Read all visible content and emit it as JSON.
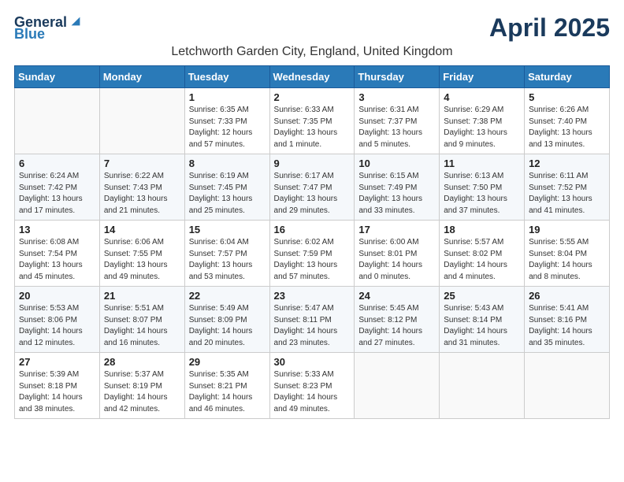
{
  "logo": {
    "general": "General",
    "blue": "Blue"
  },
  "title": "April 2025",
  "location": "Letchworth Garden City, England, United Kingdom",
  "weekdays": [
    "Sunday",
    "Monday",
    "Tuesday",
    "Wednesday",
    "Thursday",
    "Friday",
    "Saturday"
  ],
  "weeks": [
    [
      {
        "day": "",
        "info": ""
      },
      {
        "day": "",
        "info": ""
      },
      {
        "day": "1",
        "info": "Sunrise: 6:35 AM\nSunset: 7:33 PM\nDaylight: 12 hours and 57 minutes."
      },
      {
        "day": "2",
        "info": "Sunrise: 6:33 AM\nSunset: 7:35 PM\nDaylight: 13 hours and 1 minute."
      },
      {
        "day": "3",
        "info": "Sunrise: 6:31 AM\nSunset: 7:37 PM\nDaylight: 13 hours and 5 minutes."
      },
      {
        "day": "4",
        "info": "Sunrise: 6:29 AM\nSunset: 7:38 PM\nDaylight: 13 hours and 9 minutes."
      },
      {
        "day": "5",
        "info": "Sunrise: 6:26 AM\nSunset: 7:40 PM\nDaylight: 13 hours and 13 minutes."
      }
    ],
    [
      {
        "day": "6",
        "info": "Sunrise: 6:24 AM\nSunset: 7:42 PM\nDaylight: 13 hours and 17 minutes."
      },
      {
        "day": "7",
        "info": "Sunrise: 6:22 AM\nSunset: 7:43 PM\nDaylight: 13 hours and 21 minutes."
      },
      {
        "day": "8",
        "info": "Sunrise: 6:19 AM\nSunset: 7:45 PM\nDaylight: 13 hours and 25 minutes."
      },
      {
        "day": "9",
        "info": "Sunrise: 6:17 AM\nSunset: 7:47 PM\nDaylight: 13 hours and 29 minutes."
      },
      {
        "day": "10",
        "info": "Sunrise: 6:15 AM\nSunset: 7:49 PM\nDaylight: 13 hours and 33 minutes."
      },
      {
        "day": "11",
        "info": "Sunrise: 6:13 AM\nSunset: 7:50 PM\nDaylight: 13 hours and 37 minutes."
      },
      {
        "day": "12",
        "info": "Sunrise: 6:11 AM\nSunset: 7:52 PM\nDaylight: 13 hours and 41 minutes."
      }
    ],
    [
      {
        "day": "13",
        "info": "Sunrise: 6:08 AM\nSunset: 7:54 PM\nDaylight: 13 hours and 45 minutes."
      },
      {
        "day": "14",
        "info": "Sunrise: 6:06 AM\nSunset: 7:55 PM\nDaylight: 13 hours and 49 minutes."
      },
      {
        "day": "15",
        "info": "Sunrise: 6:04 AM\nSunset: 7:57 PM\nDaylight: 13 hours and 53 minutes."
      },
      {
        "day": "16",
        "info": "Sunrise: 6:02 AM\nSunset: 7:59 PM\nDaylight: 13 hours and 57 minutes."
      },
      {
        "day": "17",
        "info": "Sunrise: 6:00 AM\nSunset: 8:01 PM\nDaylight: 14 hours and 0 minutes."
      },
      {
        "day": "18",
        "info": "Sunrise: 5:57 AM\nSunset: 8:02 PM\nDaylight: 14 hours and 4 minutes."
      },
      {
        "day": "19",
        "info": "Sunrise: 5:55 AM\nSunset: 8:04 PM\nDaylight: 14 hours and 8 minutes."
      }
    ],
    [
      {
        "day": "20",
        "info": "Sunrise: 5:53 AM\nSunset: 8:06 PM\nDaylight: 14 hours and 12 minutes."
      },
      {
        "day": "21",
        "info": "Sunrise: 5:51 AM\nSunset: 8:07 PM\nDaylight: 14 hours and 16 minutes."
      },
      {
        "day": "22",
        "info": "Sunrise: 5:49 AM\nSunset: 8:09 PM\nDaylight: 14 hours and 20 minutes."
      },
      {
        "day": "23",
        "info": "Sunrise: 5:47 AM\nSunset: 8:11 PM\nDaylight: 14 hours and 23 minutes."
      },
      {
        "day": "24",
        "info": "Sunrise: 5:45 AM\nSunset: 8:12 PM\nDaylight: 14 hours and 27 minutes."
      },
      {
        "day": "25",
        "info": "Sunrise: 5:43 AM\nSunset: 8:14 PM\nDaylight: 14 hours and 31 minutes."
      },
      {
        "day": "26",
        "info": "Sunrise: 5:41 AM\nSunset: 8:16 PM\nDaylight: 14 hours and 35 minutes."
      }
    ],
    [
      {
        "day": "27",
        "info": "Sunrise: 5:39 AM\nSunset: 8:18 PM\nDaylight: 14 hours and 38 minutes."
      },
      {
        "day": "28",
        "info": "Sunrise: 5:37 AM\nSunset: 8:19 PM\nDaylight: 14 hours and 42 minutes."
      },
      {
        "day": "29",
        "info": "Sunrise: 5:35 AM\nSunset: 8:21 PM\nDaylight: 14 hours and 46 minutes."
      },
      {
        "day": "30",
        "info": "Sunrise: 5:33 AM\nSunset: 8:23 PM\nDaylight: 14 hours and 49 minutes."
      },
      {
        "day": "",
        "info": ""
      },
      {
        "day": "",
        "info": ""
      },
      {
        "day": "",
        "info": ""
      }
    ]
  ]
}
